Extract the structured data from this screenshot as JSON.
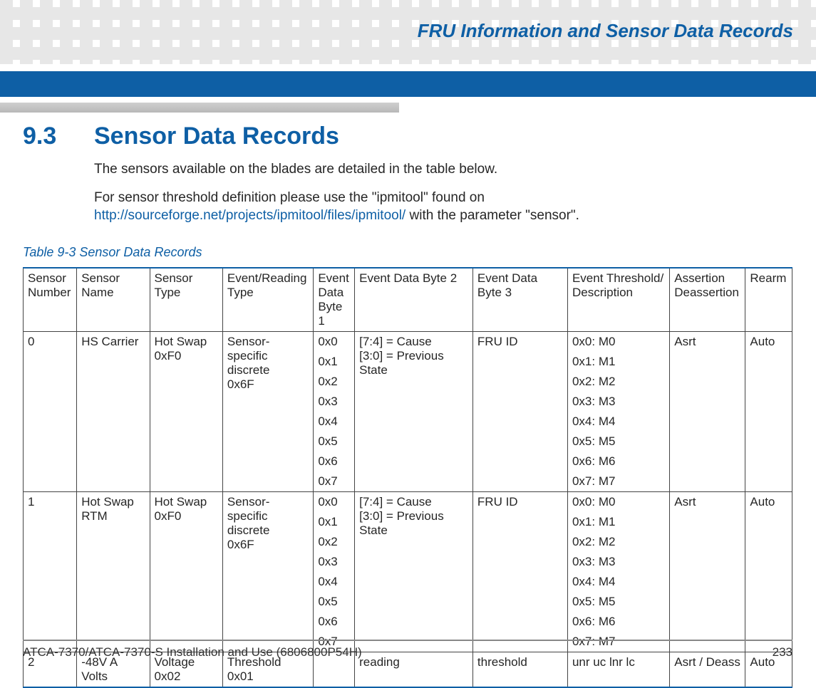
{
  "header": {
    "running_title": "FRU Information and Sensor Data Records"
  },
  "section": {
    "number": "9.3",
    "title": "Sensor Data Records"
  },
  "paragraphs": {
    "p1": "The sensors available on the blades are detailed in the table below.",
    "p2a": "For sensor threshold definition please use the \"ipmitool\" found on ",
    "p2_link": "http://sourceforge.net/projects/ipmitool/files/ipmitool/",
    "p2b": " with the parameter \"sensor\"."
  },
  "table": {
    "caption": "Table 9-3 Sensor Data Records",
    "headers": {
      "c0": "Sensor Number",
      "c1": "Sensor Name",
      "c2": "Sensor Type",
      "c3": "Event/Reading Type",
      "c4": "Event Data Byte 1",
      "c5": "Event Data Byte 2",
      "c6": "Event Data Byte 3",
      "c7": "Event Threshold/ Description",
      "c8": "Assertion Deassertion",
      "c9": "Rearm"
    },
    "rows": [
      {
        "number": "0",
        "name": "HS Carrier",
        "type_lines": [
          "Hot Swap",
          "0xF0"
        ],
        "er_lines": [
          "Sensor-specific",
          "discrete",
          "0x6F"
        ],
        "b1_lines": [
          "0x0",
          "0x1",
          "0x2",
          "0x3",
          "0x4",
          "0x5",
          "0x6",
          "0x7"
        ],
        "b2_lines": [
          "[7:4] = Cause",
          "[3:0] = Previous State"
        ],
        "b3": "FRU ID",
        "thr_lines": [
          "0x0: M0",
          "0x1: M1",
          "0x2: M2",
          "0x3: M3",
          "0x4: M4",
          "0x5: M5",
          "0x6: M6",
          "0x7: M7"
        ],
        "ad": "Asrt",
        "rearm": "Auto"
      },
      {
        "number": "1",
        "name": " Hot Swap RTM",
        "type_lines": [
          "Hot Swap",
          "0xF0"
        ],
        "er_lines": [
          "Sensor-specific",
          "discrete",
          "0x6F"
        ],
        "b1_lines": [
          "0x0",
          "0x1",
          "0x2",
          "0x3",
          "0x4",
          "0x5",
          "0x6",
          "0x7"
        ],
        "b2_lines": [
          "[7:4] = Cause",
          "[3:0] = Previous State"
        ],
        "b3": "FRU ID",
        "thr_lines": [
          "0x0: M0",
          "0x1: M1",
          "0x2: M2",
          "0x3: M3",
          "0x4: M4",
          "0x5: M5",
          "0x6: M6",
          "0x7: M7"
        ],
        "ad": "Asrt",
        "rearm": "Auto"
      },
      {
        "number": "2",
        "name": "-48V A Volts",
        "type_lines": [
          "Voltage",
          "0x02"
        ],
        "er_lines": [
          "Threshold",
          "0x01"
        ],
        "b1_lines": [
          ""
        ],
        "b2_lines": [
          "reading"
        ],
        "b3": "threshold",
        "thr_lines": [
          "unr uc lnr lc"
        ],
        "ad": "Asrt / Deass",
        "rearm": "Auto"
      }
    ]
  },
  "footer": {
    "doc": "ATCA-7370/ATCA-7370-S Installation and Use (6806800P54H)",
    "page": "233"
  }
}
